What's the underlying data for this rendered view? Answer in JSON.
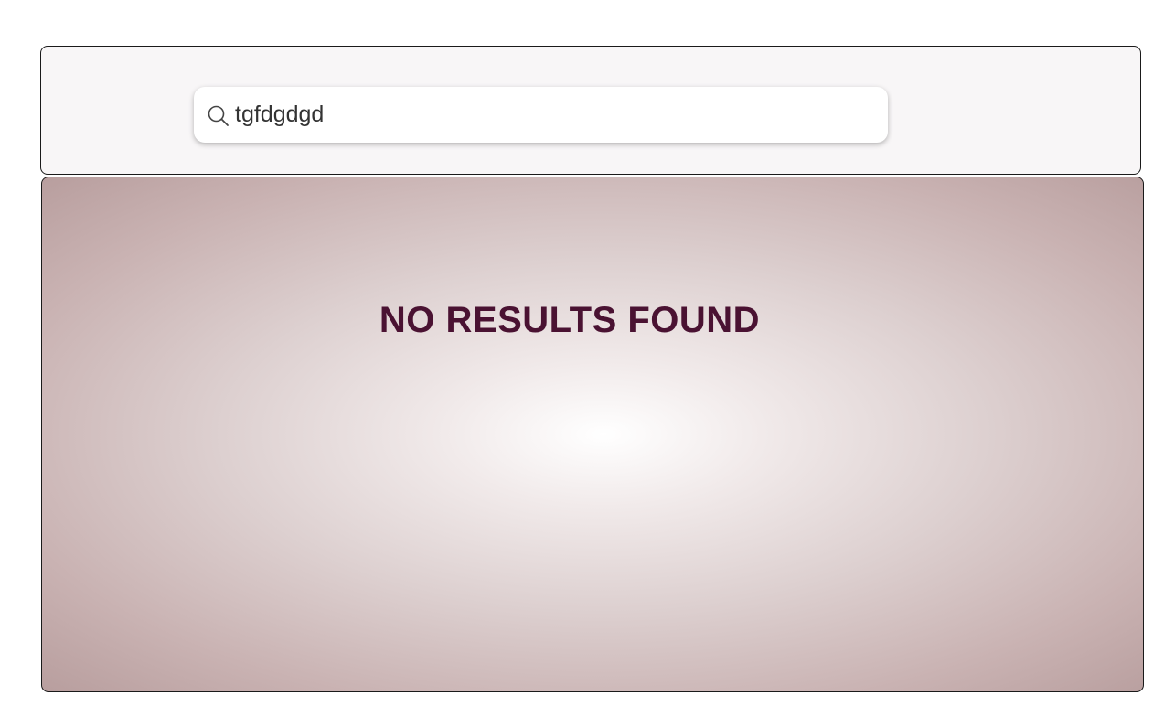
{
  "search": {
    "value": "tgfdgdgd",
    "icon": "search-icon"
  },
  "results": {
    "empty_message": "NO RESULTS FOUND"
  },
  "colors": {
    "message": "#4a1232",
    "header_bg": "#f8f6f7",
    "gradient_center": "#ffffff",
    "gradient_edge": "#b89e9e"
  }
}
